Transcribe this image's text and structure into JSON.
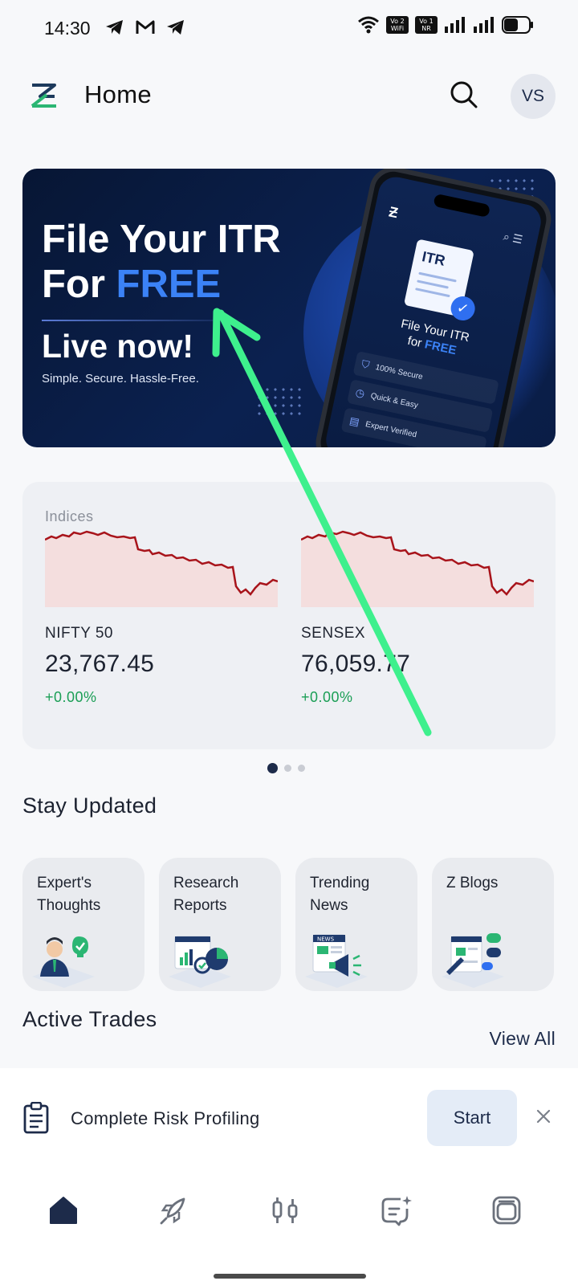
{
  "status_bar": {
    "time": "14:30",
    "left_icons": [
      "telegram-icon",
      "gmail-icon",
      "telegram-icon"
    ],
    "badge_wifi": "Vo 2 WiFi",
    "badge_nr": "Vo 1 NR"
  },
  "header": {
    "title": "Home",
    "avatar_initials": "VS",
    "logo_icon": "zebu-logo-icon",
    "search_icon": "search-icon"
  },
  "banner": {
    "line1": "File Your ITR",
    "line2_prefix": "For ",
    "line2_highlight": "FREE",
    "live": "Live now!",
    "subtitle": "Simple. Secure. Hassle-Free.",
    "phone": {
      "doc_label": "ITR",
      "title_line1": "File Your ITR",
      "title_line2_prefix": "for ",
      "title_line2_highlight": "FREE",
      "features": [
        "100% Secure",
        "Quick & Easy",
        "Expert Verified"
      ]
    }
  },
  "indices": {
    "label": "Indices",
    "items": [
      {
        "name": "NIFTY 50",
        "value": "23,767.45",
        "change": "+0.00%"
      },
      {
        "name": "SENSEX",
        "value": "76,059.77",
        "change": "+0.00%"
      }
    ],
    "pager_count": 3,
    "pager_active": 0
  },
  "stay_updated": {
    "title": "Stay Updated",
    "cards": [
      {
        "label": "Expert's Thoughts",
        "icon": "expert-icon"
      },
      {
        "label": "Research Reports",
        "icon": "research-icon"
      },
      {
        "label": "Trending News",
        "icon": "news-icon"
      },
      {
        "label": "Z Blogs",
        "icon": "blog-icon"
      }
    ]
  },
  "active_trades": {
    "title": "Active Trades",
    "view_all": "View All"
  },
  "risk_prompt": {
    "text": "Complete Risk Profiling",
    "button": "Start",
    "icon": "clipboard-icon"
  },
  "bottom_nav": {
    "items": [
      "home-icon",
      "rocket-icon",
      "candlestick-icon",
      "chat-sparkle-icon",
      "layers-icon"
    ],
    "active": 0
  },
  "colors": {
    "accent_green": "#1a9e55",
    "chart_red": "#a8141b",
    "navy": "#1d2b4a",
    "annotation_arrow": "#3ef08d"
  }
}
